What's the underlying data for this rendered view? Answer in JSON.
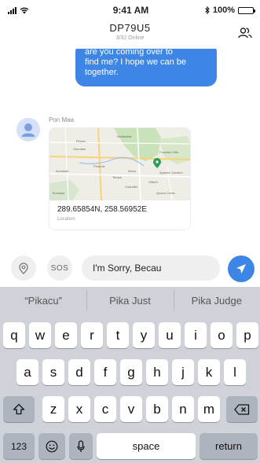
{
  "status_bar": {
    "time": "9:41 AM",
    "battery": "100%",
    "battery_level": 1.0
  },
  "header": {
    "title": "DP79U5",
    "subtitle": "3/32 Online"
  },
  "messages": {
    "outgoing": {
      "lines": [
        "are you coming over to",
        "find me? I hope we can be",
        "together."
      ]
    },
    "incoming": {
      "sender": "Pon Maa",
      "location": {
        "coords": "289.65854N, 258.56952E",
        "label": "Location",
        "map_labels": [
          "Peoria",
          "Glendale",
          "Phoenix",
          "Mesa",
          "Scottsdale",
          "Tempe",
          "Chandler",
          "Gilbert",
          "Avondale",
          "Buckeye",
          "Apache Junction",
          "Fountain Hills",
          "Queen Creek"
        ]
      }
    }
  },
  "input_bar": {
    "sos_label": "SOS",
    "message_value": "I'm Sorry, Becau"
  },
  "keyboard": {
    "suggestions": [
      "“Pikacu”",
      "Pika Just",
      "Pika Judge"
    ],
    "row1": [
      "q",
      "w",
      "e",
      "r",
      "t",
      "y",
      "u",
      "i",
      "o",
      "p"
    ],
    "row2": [
      "a",
      "s",
      "d",
      "f",
      "g",
      "h",
      "j",
      "k",
      "l"
    ],
    "row3": [
      "z",
      "x",
      "c",
      "v",
      "b",
      "n",
      "m"
    ],
    "numbers_label": "123",
    "space_label": "space",
    "return_label": "return"
  },
  "colors": {
    "accent": "#3d86e6",
    "keyboard_bg": "#cfd3d9",
    "field_bg": "#efefef"
  },
  "icons": {
    "members": "group-icon",
    "location": "location-pin-icon",
    "send": "send-arrow-icon",
    "shift": "shift-icon",
    "delete": "backspace-icon",
    "emoji": "emoji-icon",
    "mic": "microphone-icon"
  }
}
